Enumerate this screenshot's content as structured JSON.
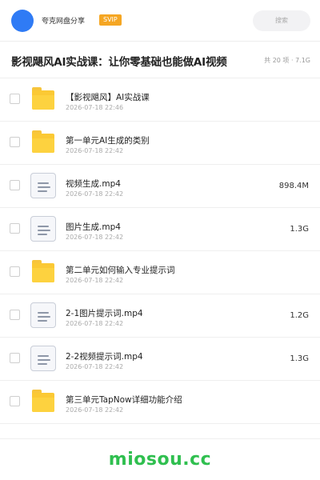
{
  "header": {
    "app_name": "夸克网盘分享",
    "vip_label": "SVIP",
    "search_placeholder": "搜索"
  },
  "title": {
    "text": "影视飓风AI实战课：让你零基础也能做AI视频",
    "meta": "共 20 项 · 7.1G"
  },
  "files": [
    {
      "type": "folder",
      "name": "【影视飓风】AI实战课",
      "date": "2026-07-18 22:46",
      "size": ""
    },
    {
      "type": "folder",
      "name": "第一单元AI生成的类别",
      "date": "2026-07-18 22:42",
      "size": ""
    },
    {
      "type": "video",
      "name": "视频生成.mp4",
      "date": "2026-07-18 22:42",
      "size": "898.4M"
    },
    {
      "type": "video",
      "name": "图片生成.mp4",
      "date": "2026-07-18 22:42",
      "size": "1.3G"
    },
    {
      "type": "folder",
      "name": "第二单元如何输入专业提示词",
      "date": "2026-07-18 22:42",
      "size": ""
    },
    {
      "type": "video",
      "name": "2-1图片提示词.mp4",
      "date": "2026-07-18 22:42",
      "size": "1.2G"
    },
    {
      "type": "video",
      "name": "2-2视频提示词.mp4",
      "date": "2026-07-18 22:42",
      "size": "1.3G"
    },
    {
      "type": "folder",
      "name": "第三单元TapNow详细功能介绍",
      "date": "2026-07-18 22:42",
      "size": ""
    }
  ],
  "watermark": "miosou.cc",
  "colors": {
    "avatar": "#2f7bf5",
    "vip_badge": "#f5a623",
    "folder": "#fbc934",
    "watermark": "#2fbf4f"
  }
}
